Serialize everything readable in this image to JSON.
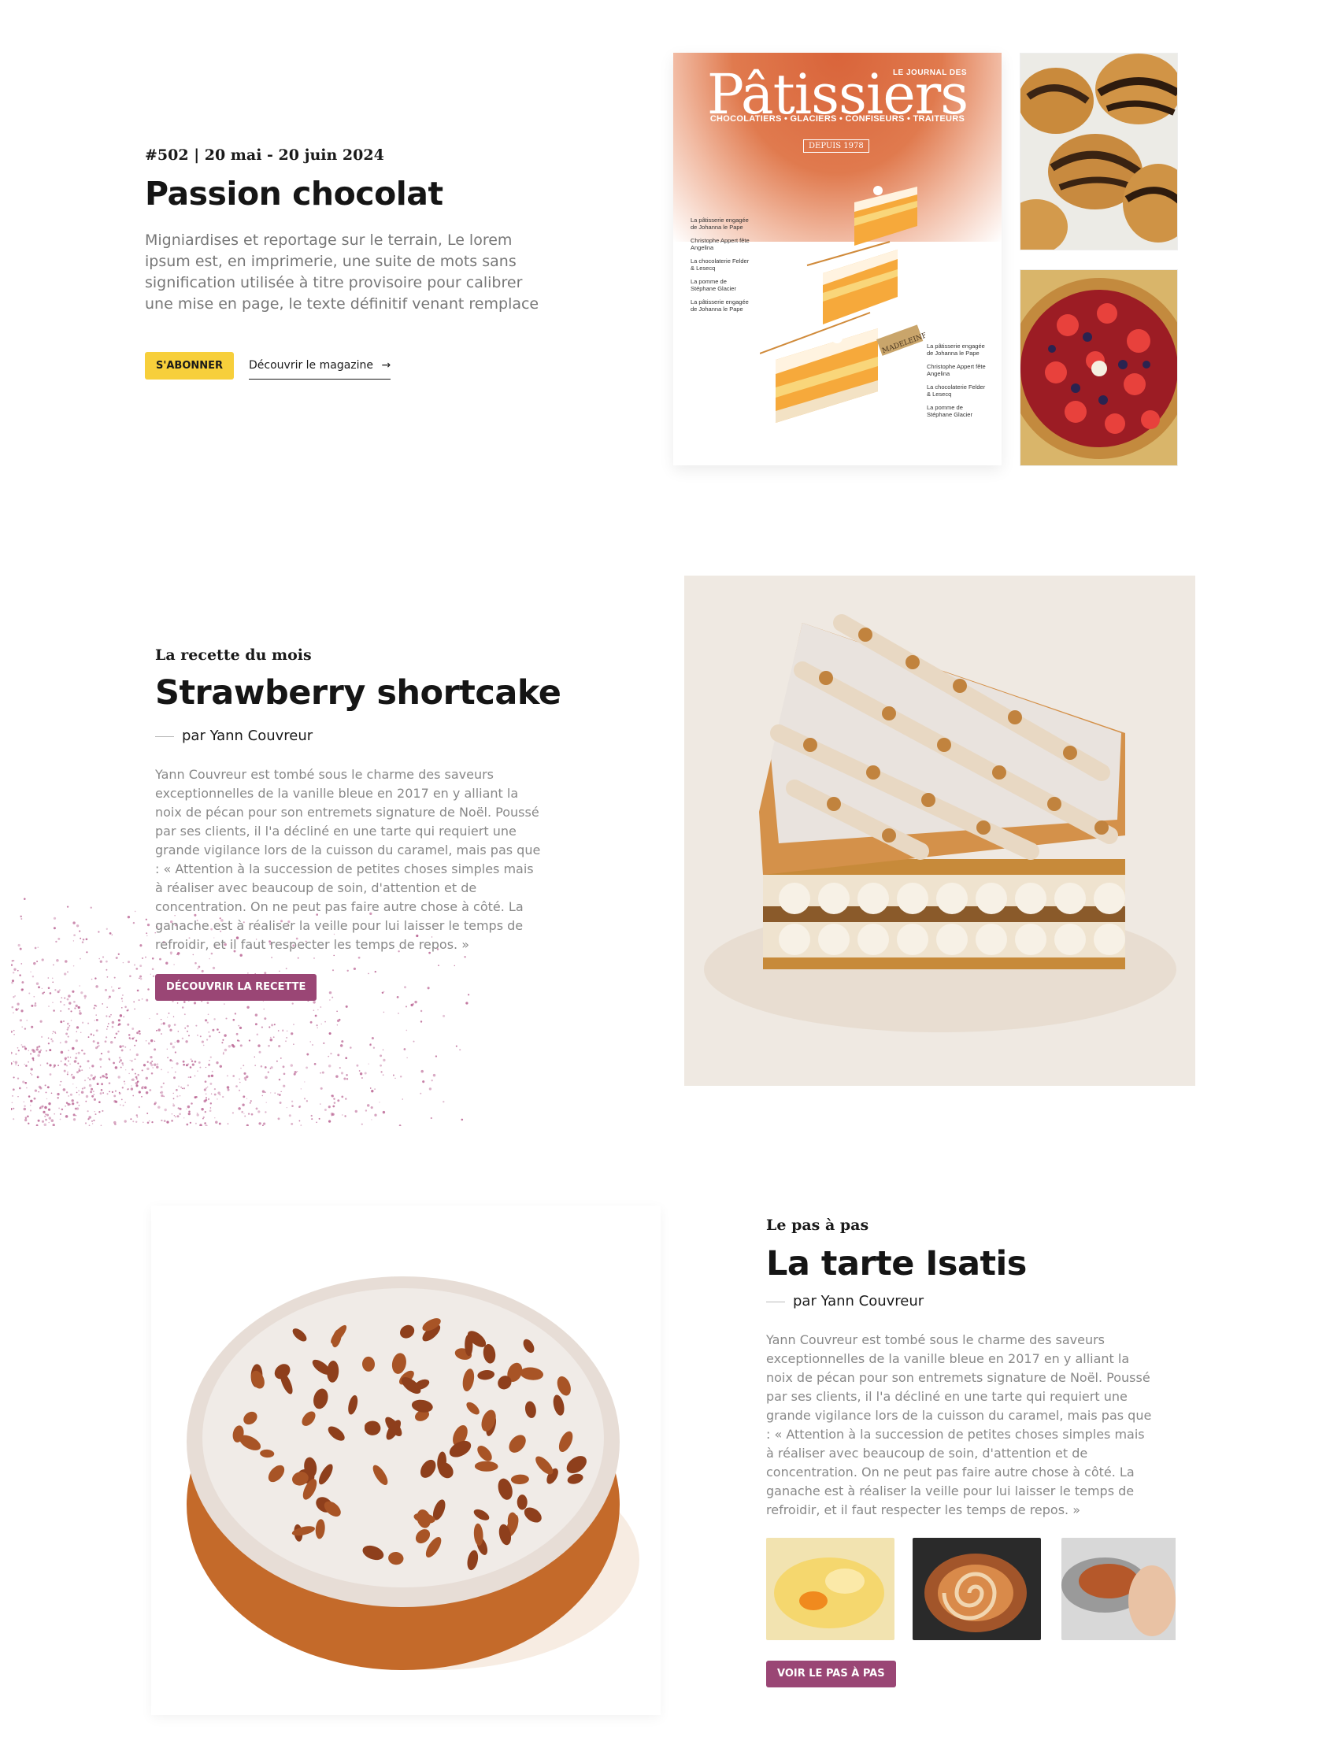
{
  "magazine": {
    "issue": "#502 |",
    "dates": "20 mai - 20 juin 2024",
    "title": "Passion chocolat",
    "lead": "Migniardises et reportage sur le terrain,  Le  lorem ipsum est, en imprimerie, une suite de mots sans signification utilisée à titre provisoire pour calibrer une mise en page, le texte définitif venant remplace",
    "subscribe_label": "S'ABONNER",
    "discover_label": "Découvrir le magazine",
    "cover": {
      "journal_label": "LE JOURNAL DES",
      "brand": "Pâtissiers",
      "subtitle": "CHOCOLATIERS • GLACIERS • CONFISEURS • TRAITEURS",
      "since": "DEPUIS 1978",
      "notes_left": [
        "La pâtisserie engagée de Johanna le Pape",
        "Christophe Appert fête Angelina",
        "La chocolaterie Felder & Lesecq",
        "La pomme de Stéphane Glacier",
        "La pâtisserie engagée de Johanna le Pape"
      ],
      "notes_right": [
        "La pâtisserie engagée de Johanna le Pape",
        "Christophe Appert fête Angelina",
        "La chocolaterie Felder & Lesecq",
        "La pomme de Stéphane Glacier"
      ],
      "tag_label": "MADELEINE"
    }
  },
  "recipe": {
    "kicker": "La recette du mois",
    "title": "Strawberry shortcake",
    "author": "par Yann Couvreur",
    "body": "Yann Couvreur est tombé sous le charme des saveurs exceptionnelles de la vanille bleue en 2017 en y alliant la noix de pécan pour son entremets signature de Noël. Poussé par ses clients, il l'a décliné en une tarte qui requiert une grande vigilance lors de la cuisson du caramel, mais pas que : « Attention à la succession de petites choses simples mais à réaliser avec beaucoup de soin, d'attention et de concentration. On ne peut pas faire autre chose à côté. La ganache est à réaliser la veille pour lui laisser le temps de refroidir, et il faut respecter les temps de repos. »",
    "cta_label": "DÉCOUVRIR LA RECETTE"
  },
  "step_by_step": {
    "kicker": "Le pas à pas",
    "title": "La tarte Isatis",
    "author": "par Yann Couvreur",
    "body": "Yann Couvreur est tombé sous le charme des saveurs exceptionnelles de la vanille bleue en 2017 en y alliant la noix de pécan pour son entremets signature de Noël. Poussé par ses clients, il l'a décliné en une tarte qui requiert une grande vigilance lors de la cuisson du caramel, mais pas que : « Attention à la succession de petites choses simples mais à réaliser avec beaucoup de soin, d'attention et de concentration. On ne peut pas faire autre chose à côté. La ganache est à réaliser la veille pour lui laisser le temps de refroidir, et il faut respecter les temps de repos. »",
    "cta_label": "VOIR LE PAS À PAS"
  },
  "colors": {
    "accent_yellow": "#f7cf3b",
    "accent_plum": "#9a4675",
    "cover_orange": "#d9643a"
  }
}
